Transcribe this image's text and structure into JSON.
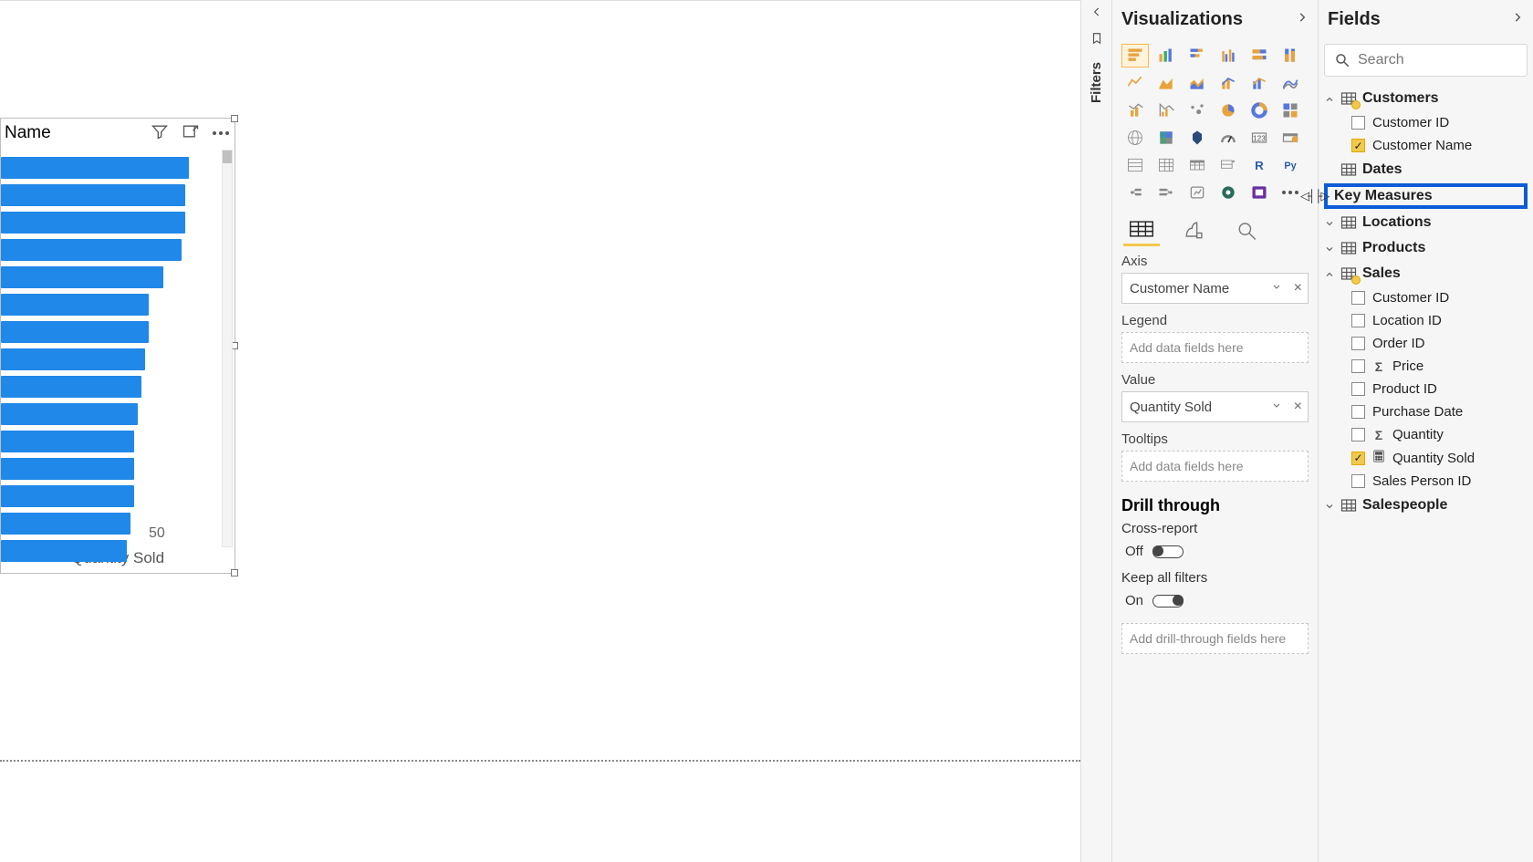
{
  "chart": {
    "title_visible": "Name",
    "tick_label": "50",
    "xlabel": "Quantity Sold"
  },
  "chart_data": {
    "type": "bar",
    "orientation": "horizontal",
    "title": "… by Customer Name",
    "xlabel": "Quantity Sold",
    "ylabel": "",
    "xlim": [
      0,
      60
    ],
    "ticks": [
      50
    ],
    "categories": [
      "",
      "",
      "",
      "",
      "",
      "",
      "",
      "",
      "",
      "",
      "",
      "",
      "",
      "",
      ""
    ],
    "values": [
      59,
      58,
      58,
      57,
      52,
      48,
      48,
      47,
      46,
      45,
      44,
      44,
      44,
      43,
      42
    ]
  },
  "filters_rail": {
    "label": "Filters"
  },
  "viz_pane": {
    "title": "Visualizations",
    "wells": {
      "axis_label": "Axis",
      "axis_value": "Customer Name",
      "legend_label": "Legend",
      "legend_placeholder": "Add data fields here",
      "value_label": "Value",
      "value_value": "Quantity Sold",
      "tooltips_label": "Tooltips",
      "tooltips_placeholder": "Add data fields here"
    },
    "drill": {
      "title": "Drill through",
      "cross_report_label": "Cross-report",
      "cross_report_state": "Off",
      "keep_filters_label": "Keep all filters",
      "keep_filters_state": "On",
      "drop_placeholder": "Add drill-through fields here"
    }
  },
  "fields_pane": {
    "title": "Fields",
    "search_placeholder": "Search",
    "tables": {
      "customers": {
        "name": "Customers",
        "fields": [
          {
            "name": "Customer ID",
            "checked": false
          },
          {
            "name": "Customer Name",
            "checked": true
          }
        ]
      },
      "dates": {
        "name": "Dates"
      },
      "key_measures": {
        "name": "Key Measures"
      },
      "locations": {
        "name": "Locations"
      },
      "products": {
        "name": "Products"
      },
      "sales": {
        "name": "Sales",
        "fields": [
          {
            "name": "Customer ID",
            "checked": false
          },
          {
            "name": "Location ID",
            "checked": false
          },
          {
            "name": "Order ID",
            "checked": false
          },
          {
            "name": "Price",
            "checked": false,
            "sigma": true
          },
          {
            "name": "Product ID",
            "checked": false
          },
          {
            "name": "Purchase Date",
            "checked": false
          },
          {
            "name": "Quantity",
            "checked": false,
            "sigma": true
          },
          {
            "name": "Quantity Sold",
            "checked": true,
            "calc": true
          },
          {
            "name": "Sales Person ID",
            "checked": false
          }
        ]
      },
      "salespeople": {
        "name": "Salespeople"
      }
    }
  }
}
